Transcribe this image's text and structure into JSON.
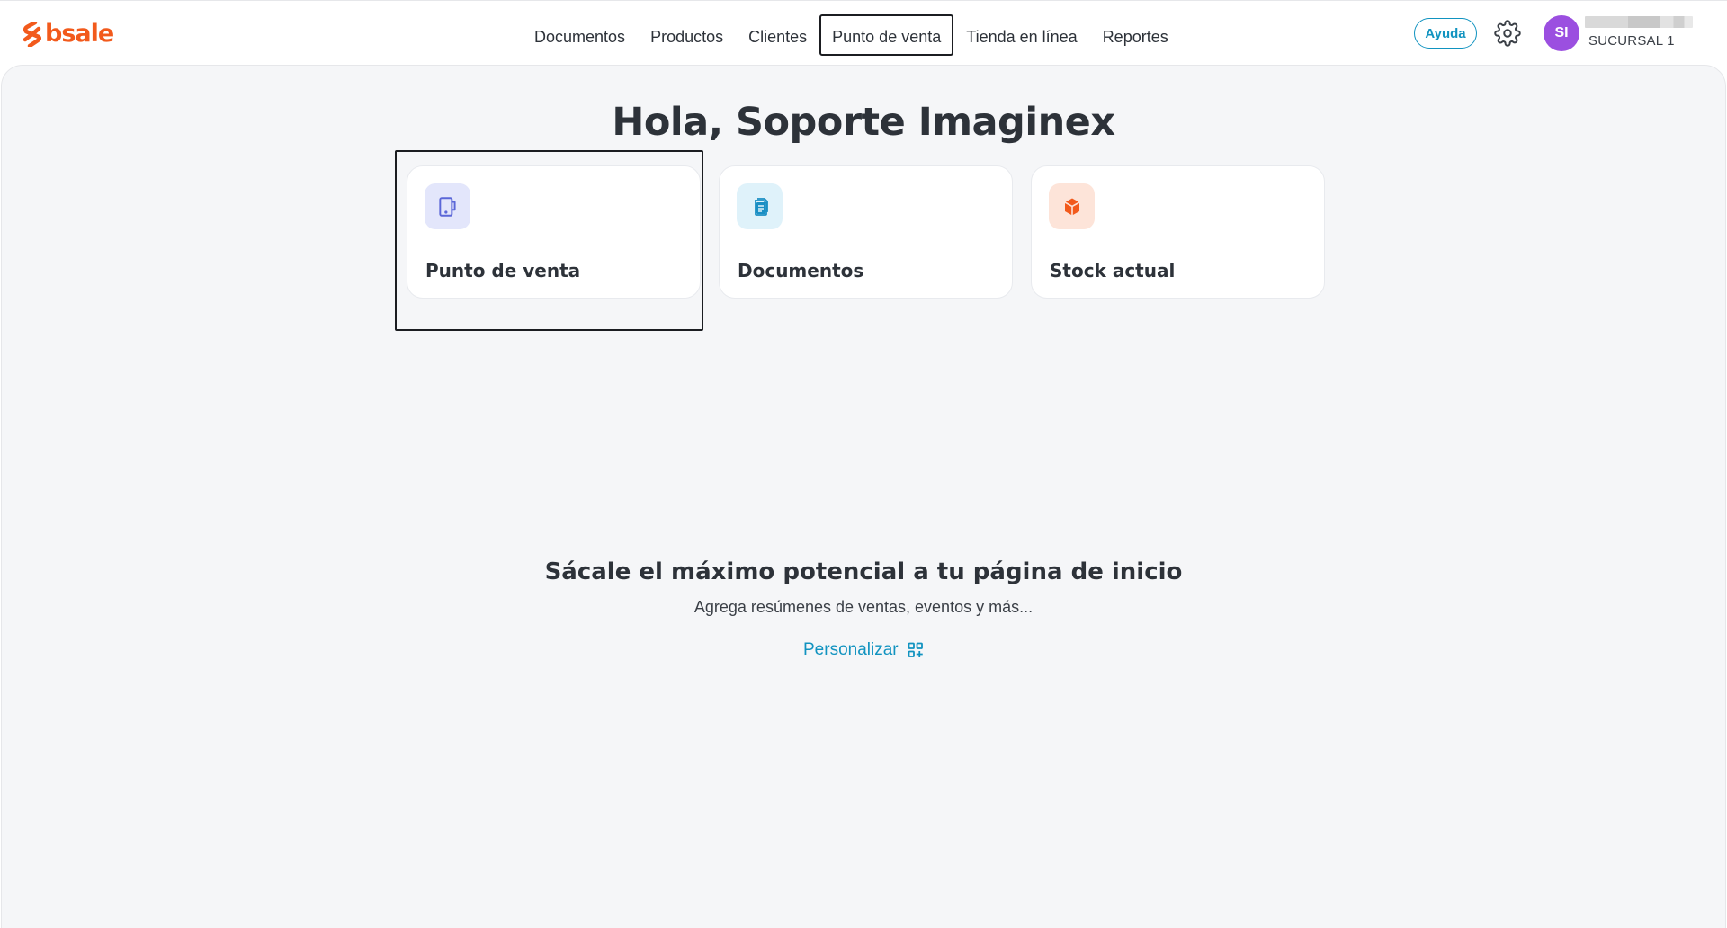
{
  "header": {
    "logo_text": "bsale",
    "nav": [
      {
        "label": "Documentos"
      },
      {
        "label": "Productos"
      },
      {
        "label": "Clientes"
      },
      {
        "label": "Punto de venta"
      },
      {
        "label": "Tienda en línea"
      },
      {
        "label": "Reportes"
      }
    ],
    "active_nav": "Punto de venta",
    "help_label": "Ayuda",
    "settings_icon": "gear-icon",
    "user_initials": "SI",
    "branch": "SUCURSAL 1"
  },
  "main": {
    "greeting": "Hola, Soporte Imaginex",
    "cards": [
      {
        "label": "Punto de venta",
        "icon": "tablet-icon",
        "color": "#5b67d8",
        "bg": "#e3e6fb"
      },
      {
        "label": "Documentos",
        "icon": "document-icon",
        "color": "#1a8fc4",
        "bg": "#dff2fa"
      },
      {
        "label": "Stock actual",
        "icon": "box-icon",
        "color": "#f25a1c",
        "bg": "#fde4d9"
      }
    ],
    "promo": {
      "title": "Sácale el máximo potencial a tu página de inicio",
      "subtitle": "Agrega resúmenes de ventas, eventos y más...",
      "action_label": "Personalizar",
      "action_icon": "widgets-add-icon"
    }
  },
  "colors": {
    "brand": "#f25a1c",
    "accent": "#1193c0",
    "avatar": "#9b4fe0",
    "background": "#f5f6f8"
  }
}
